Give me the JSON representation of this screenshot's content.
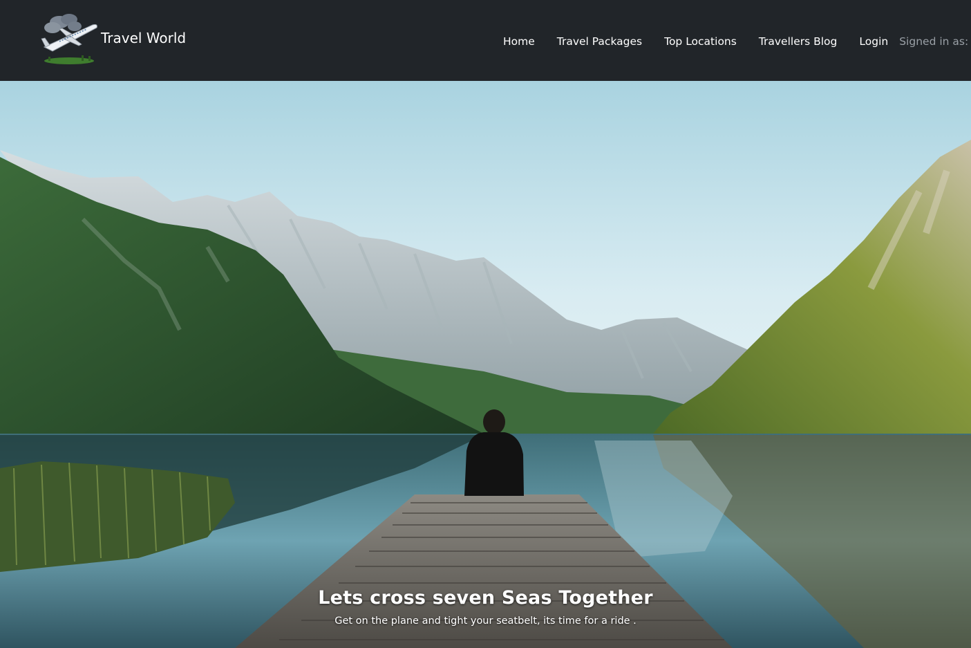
{
  "brand": {
    "name": "Travel World",
    "logo_icon": "airplane-icon"
  },
  "nav": {
    "items": [
      {
        "label": "Home"
      },
      {
        "label": "Travel Packages"
      },
      {
        "label": "Top Locations"
      },
      {
        "label": "Travellers Blog"
      },
      {
        "label": "Login"
      }
    ],
    "signed_in": "Signed in as:"
  },
  "hero": {
    "title": "Lets cross seven Seas Together",
    "subtitle": "Get on the plane and tight your seatbelt, its time for a ride ."
  },
  "colors": {
    "navbar_bg": "#212529",
    "nav_text": "#ffffff",
    "muted_text": "#9aa0a6"
  }
}
